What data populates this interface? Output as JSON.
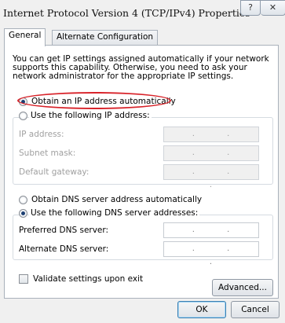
{
  "window": {
    "title": "Internet Protocol Version 4 (TCP/IPv4) Properties",
    "help_label": "?",
    "close_label": "✕"
  },
  "tabs": [
    {
      "label": "General"
    },
    {
      "label": "Alternate Configuration"
    }
  ],
  "description": "You can get IP settings assigned automatically if your network supports this capability. Otherwise, you need to ask your network administrator for the appropriate IP settings.",
  "ip": {
    "auto_label": "Obtain an IP address automatically",
    "manual_label": "Use the following IP address:",
    "fields": [
      {
        "label": "IP address:",
        "value": ". . ."
      },
      {
        "label": "Subnet mask:",
        "value": ". . ."
      },
      {
        "label": "Default gateway:",
        "value": ". . ."
      }
    ]
  },
  "dns": {
    "auto_label": "Obtain DNS server address automatically",
    "manual_label": "Use the following DNS server addresses:",
    "fields": [
      {
        "label": "Preferred DNS server:",
        "value": ". . ."
      },
      {
        "label": "Alternate DNS server:",
        "value": ". . ."
      }
    ]
  },
  "validate_label": "Validate settings upon exit",
  "buttons": {
    "advanced": "Advanced...",
    "ok": "OK",
    "cancel": "Cancel"
  },
  "colors": {
    "highlight": "#d8232a",
    "radio_dot": "#1c3f72"
  }
}
